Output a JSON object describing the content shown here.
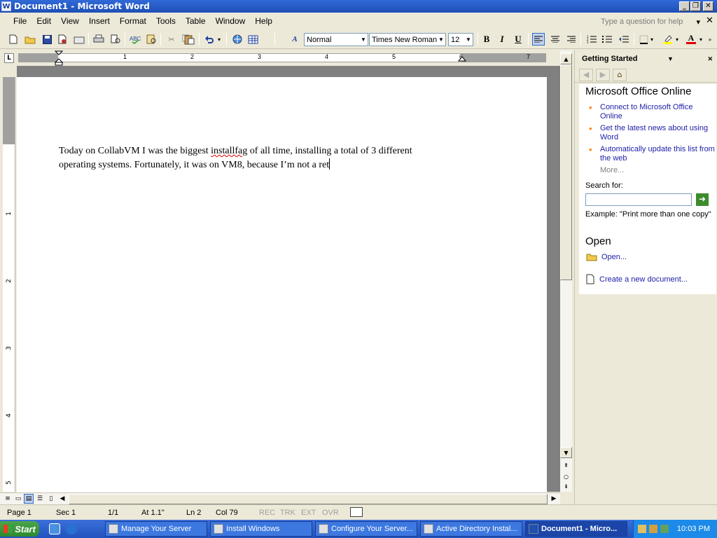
{
  "window": {
    "title": "Document1 - Microsoft Word",
    "app_icon": "W"
  },
  "menu": [
    "File",
    "Edit",
    "View",
    "Insert",
    "Format",
    "Tools",
    "Table",
    "Window",
    "Help"
  ],
  "help": {
    "placeholder": "Type a question for help"
  },
  "formatting": {
    "style": "Normal",
    "font": "Times New Roman",
    "size": "12",
    "bold": "B",
    "italic": "I",
    "underline": "U",
    "font_color_letter": "A"
  },
  "ruler": {
    "h_numbers": [
      "1",
      "2",
      "3",
      "4",
      "5",
      "6",
      "7"
    ],
    "v_numbers": [
      "1",
      "2",
      "3",
      "4",
      "5"
    ]
  },
  "document": {
    "text_before": "Today on CollabVM I was the biggest ",
    "misspelled": "installfag",
    "text_after": " of all time, installing a total of 3 different operating systems. Fortunately, it was on VM8, because I’m not a ret"
  },
  "taskpane": {
    "title": "Getting Started",
    "heading": "Microsoft Office Online",
    "links": [
      "Connect to Microsoft Office Online",
      "Get the latest news about using Word",
      "Automatically update this list from the web"
    ],
    "more": "More...",
    "search_label": "Search for:",
    "example": "Example:  \"Print more than one copy\"",
    "open_heading": "Open",
    "open_link": "Open...",
    "create_link": "Create a new document..."
  },
  "status": {
    "page": "Page 1",
    "sec": "Sec 1",
    "pages": "1/1",
    "at": "At  1.1\"",
    "ln": "Ln 2",
    "col": "Col 79",
    "rec": "REC",
    "trk": "TRK",
    "ext": "EXT",
    "ovr": "OVR"
  },
  "taskbar": {
    "start": "Start",
    "tasks": [
      "Manage Your Server",
      "Install Windows",
      "Configure Your Server...",
      "Active Directory Instal...",
      "Document1 - Micro..."
    ],
    "clock": "10:03 PM"
  },
  "colors": {
    "titlebar": "#2456c8",
    "link": "#1c1ca8",
    "bullet": "#ff8000",
    "squiggle": "#dd0000"
  }
}
